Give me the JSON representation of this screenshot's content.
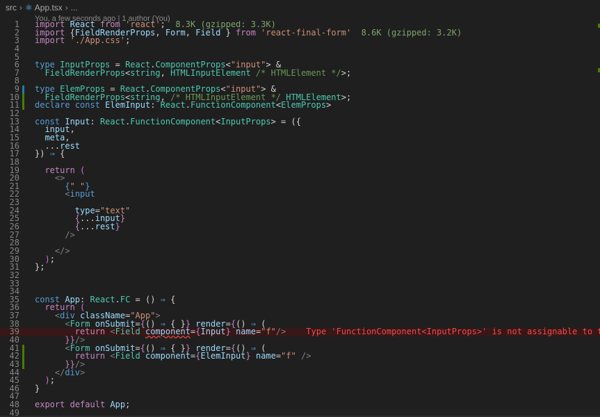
{
  "breadcrumb": {
    "folder": "src",
    "file": "App.tsx",
    "more": "..."
  },
  "blame": "You, a few seconds ago | 1 author (You)",
  "imports": {
    "size1": "8.3K (gzipped: 3.3K)",
    "size2": "8.6K (gzipped: 3.2K)"
  },
  "error_message": "Type 'FunctionComponent<InputProps>' is not assignable to t",
  "line_numbers": [
    "1",
    "2",
    "3",
    "4",
    "5",
    "6",
    "7",
    "8",
    "9",
    "10",
    "11",
    "12",
    "13",
    "14",
    "15",
    "16",
    "17",
    "18",
    "19",
    "20",
    "21",
    "22",
    "23",
    "24",
    "25",
    "26",
    "27",
    "28",
    "29",
    "30",
    "31",
    "32",
    "33",
    "34",
    "35",
    "36",
    "37",
    "38",
    "39",
    "40",
    "41",
    "42",
    "43",
    "44",
    "45",
    "46",
    "47",
    "48",
    "49"
  ]
}
